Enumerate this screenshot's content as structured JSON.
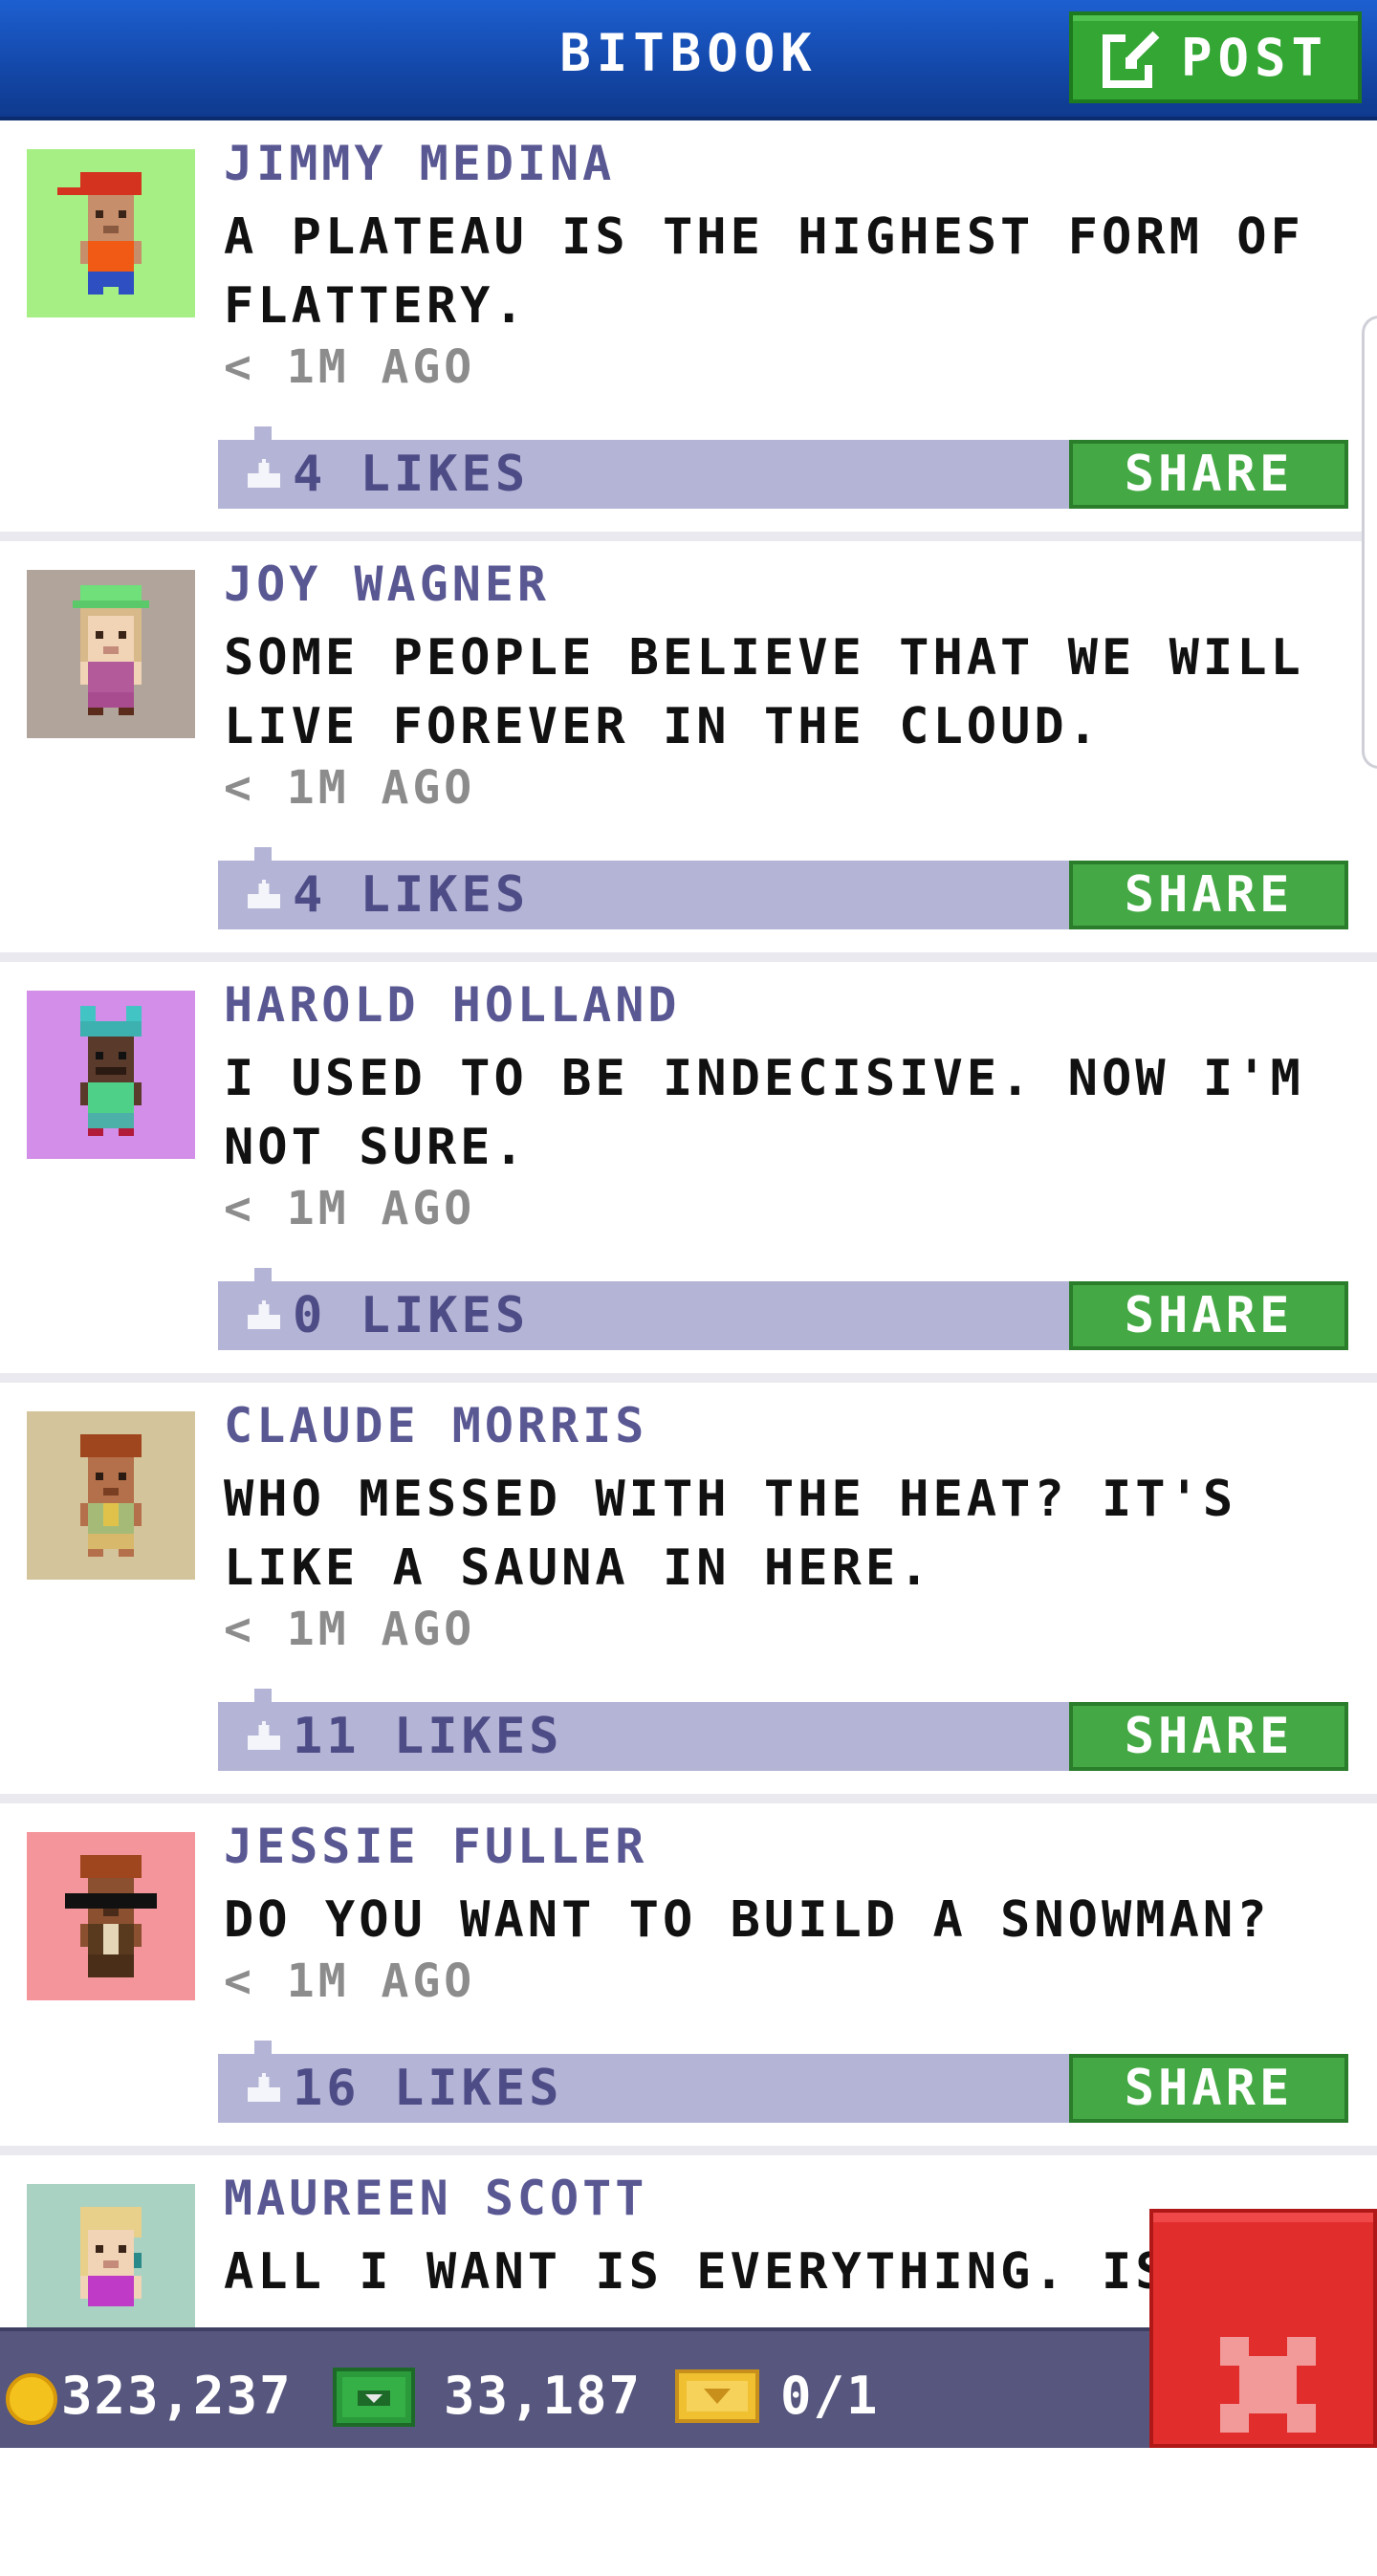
{
  "header": {
    "title": "BITBOOK",
    "post_label": "POST"
  },
  "colors": {
    "header_blue": "#1347a8",
    "button_green": "#44a944",
    "likes_bar": "#b4b4d6",
    "author_purple": "#5a5893",
    "close_red": "#e22d2d",
    "bottom_bar": "#56567e"
  },
  "posts": [
    {
      "author": "JIMMY MEDINA",
      "message": "A PLATEAU IS THE HIGHEST FORM OF FLATTERY.",
      "time": "< 1M AGO",
      "likes": "4 LIKES",
      "share": "SHARE",
      "avatar_bg": "#a6ef84"
    },
    {
      "author": "JOY WAGNER",
      "message": "SOME PEOPLE BELIEVE THAT WE WILL LIVE FOREVER IN THE CLOUD.",
      "time": "< 1M AGO",
      "likes": "4 LIKES",
      "share": "SHARE",
      "avatar_bg": "#b1a49b"
    },
    {
      "author": "HAROLD HOLLAND",
      "message": "I USED TO BE INDECISIVE. NOW I'M NOT SURE.",
      "time": "< 1M AGO",
      "likes": "0 LIKES",
      "share": "SHARE",
      "avatar_bg": "#d28ee8"
    },
    {
      "author": "CLAUDE MORRIS",
      "message": "WHO MESSED WITH THE HEAT? IT'S LIKE A SAUNA IN HERE.",
      "time": "< 1M AGO",
      "likes": "11 LIKES",
      "share": "SHARE",
      "avatar_bg": "#d4c49c"
    },
    {
      "author": "JESSIE FULLER",
      "message": "DO YOU WANT TO BUILD A SNOWMAN?",
      "time": "< 1M AGO",
      "likes": "16 LIKES",
      "share": "SHARE",
      "avatar_bg": "#f4949b"
    },
    {
      "author": "MAUREEN SCOTT",
      "message": "ALL I WANT IS EVERYTHING. IS T",
      "avatar_bg": "#a9d2c2"
    }
  ],
  "bottom_bar": {
    "coins": "323,237",
    "bux": "33,187",
    "tickets": "0/1"
  },
  "icons": [
    "pencil-icon",
    "thumb-up-icon",
    "coin-icon",
    "bux-icon",
    "ticket-icon",
    "close-icon"
  ]
}
